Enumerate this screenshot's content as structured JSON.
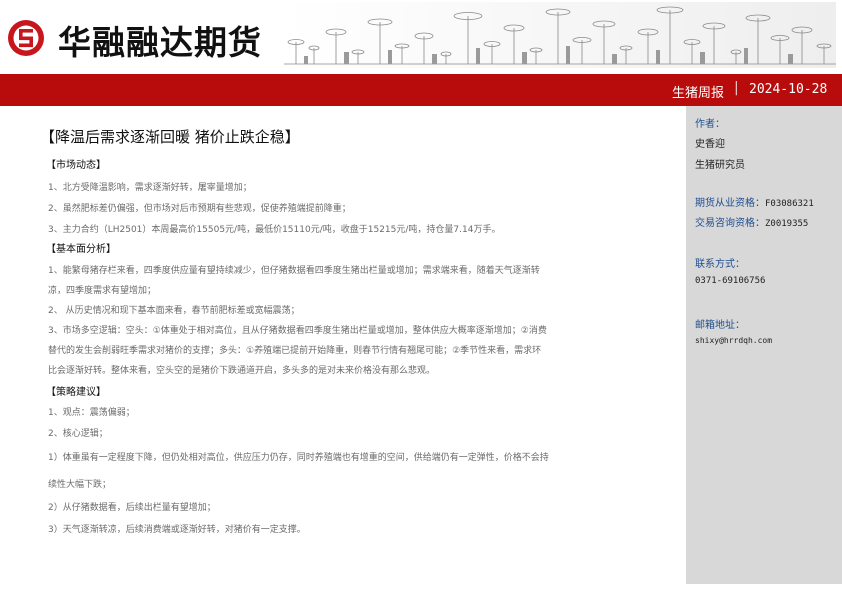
{
  "header": {
    "company_name": "华融融达期货",
    "report_type": "生猪周报",
    "separator": "|",
    "date": "2024-10-28"
  },
  "report": {
    "title": "【降温后需求逐渐回暖  猪价止跌企稳】",
    "sections": [
      {
        "heading": "【市场动态】",
        "lines": [
          "1、北方受降温影响，需求逐渐好转，屠宰量增加；",
          "2、虽然肥标差仍偏强，但市场对后市预期有些悲观，促使养殖端提前降重；",
          "3、主力合约（LH2501）本周最高价15505元/吨，最低价15110元/吨，收盘于15215元/吨，持仓量7.14万手。"
        ]
      },
      {
        "heading": "【基本面分析】",
        "lines": [
          "1、能繁母猪存栏来看，四季度供应量有望持续减少，但仔猪数据看四季度生猪出栏量或增加；需求端来看，随着天气逐渐转",
          "凉，四季度需求有望增加；",
          "2、 从历史情况和现下基本面来看，春节前肥标差或宽幅震荡；",
          "3、市场多空逻辑：空头：①体重处于相对高位，且从仔猪数据看四季度生猪出栏量或增加，整体供应大概率逐渐增加；②消费",
          "替代的发生会削弱旺季需求对猪价的支撑；多头：①养殖端已提前开始降重，则春节行情有翘尾可能；②季节性来看，需求环",
          "比会逐渐好转。整体来看，空头空的是猪价下跌通道开启，多头多的是对未来价格没有那么悲观。"
        ]
      },
      {
        "heading": "【策略建议】",
        "lines": [
          "1、观点：震荡偏弱；",
          "2、核心逻辑；",
          "1）体重虽有一定程度下降，但仍处相对高位，供应压力仍存，同时养殖端也有增重的空间，供给端仍有一定弹性，价格不会持",
          "续性大幅下跌；",
          "2）从仔猪数据看，后续出栏量有望增加；",
          "3）天气逐渐转凉，后续消费端或逐渐好转，对猪价有一定支撑。"
        ]
      }
    ]
  },
  "sidebar": {
    "author_label": "作者：",
    "author_name": "史香迎",
    "author_title": "生猪研究员",
    "futures_qual_label": "期货从业资格：",
    "futures_qual_value": "F03086321",
    "consult_qual_label": "交易咨询资格：",
    "consult_qual_value": "Z0019355",
    "contact_label": "联系方式：",
    "contact_value": "0371-69106756",
    "email_label": "邮箱地址：",
    "email_value": "shixy@hrrdqh.com"
  },
  "colors": {
    "brand_red": "#b80b0b",
    "sidebar_bg": "#d8d8d8",
    "label_blue": "#1f4e91"
  }
}
